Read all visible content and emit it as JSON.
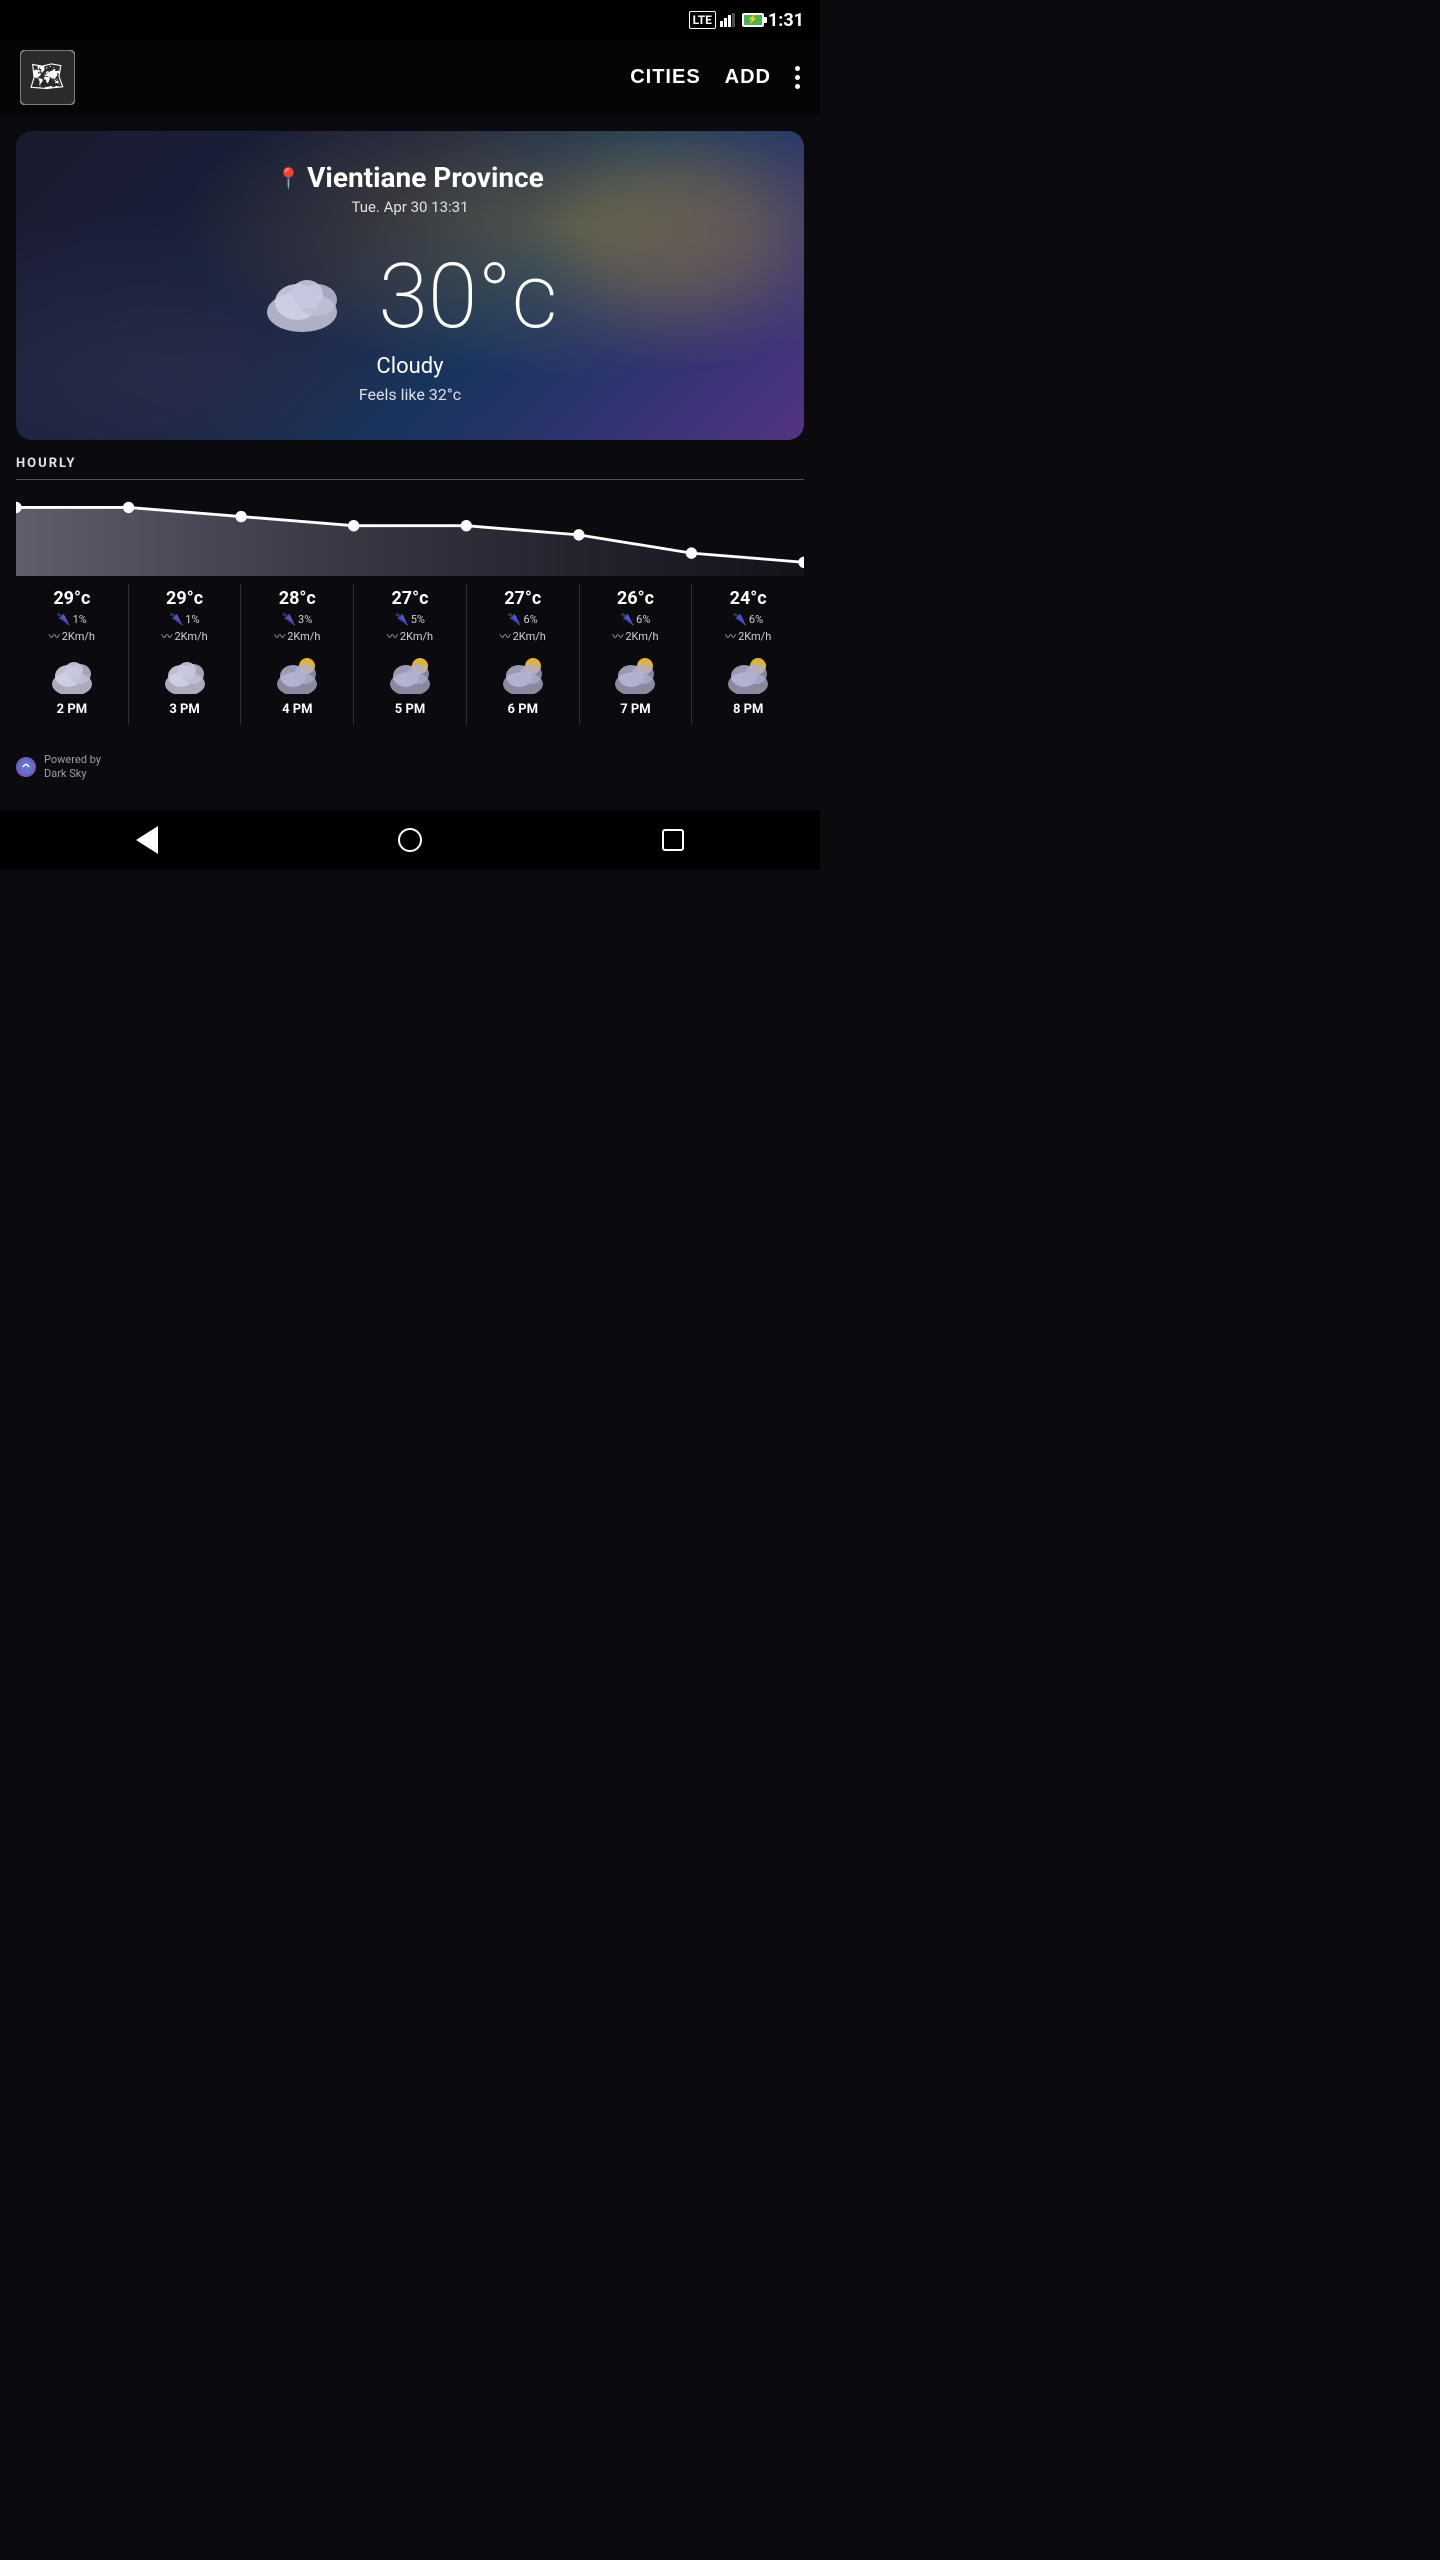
{
  "statusBar": {
    "time": "1:31",
    "lte": "LTE"
  },
  "nav": {
    "cities_label": "CITIES",
    "add_label": "ADD"
  },
  "weather": {
    "city": "Vientiane Province",
    "datetime": "Tue. Apr 30 13:31",
    "temperature": "30°c",
    "condition": "Cloudy",
    "feelsLike": "Feels like 32°c"
  },
  "hourly": {
    "section_label": "HOURLY",
    "hours": [
      {
        "time": "2 PM",
        "temp": "29°c",
        "rain": "1%",
        "wind": "2Km/h",
        "icon": "cloud"
      },
      {
        "time": "3 PM",
        "temp": "29°c",
        "rain": "1%",
        "wind": "2Km/h",
        "icon": "cloud"
      },
      {
        "time": "4 PM",
        "temp": "28°c",
        "rain": "3%",
        "wind": "2Km/h",
        "icon": "cloud-moon"
      },
      {
        "time": "5 PM",
        "temp": "27°c",
        "rain": "5%",
        "wind": "2Km/h",
        "icon": "cloud-moon"
      },
      {
        "time": "6 PM",
        "temp": "27°c",
        "rain": "6%",
        "wind": "2Km/h",
        "icon": "cloud-moon"
      },
      {
        "time": "7 PM",
        "temp": "26°c",
        "rain": "6%",
        "wind": "2Km/h",
        "icon": "cloud-moon"
      },
      {
        "time": "8 PM",
        "temp": "24°c",
        "rain": "6%",
        "wind": "2Km/h",
        "icon": "cloud-moon"
      }
    ],
    "chartPoints": [
      29,
      29,
      28,
      27,
      27,
      26,
      24
    ]
  },
  "footer": {
    "powered_by": "Powered by",
    "brand": "Dark Sky"
  }
}
